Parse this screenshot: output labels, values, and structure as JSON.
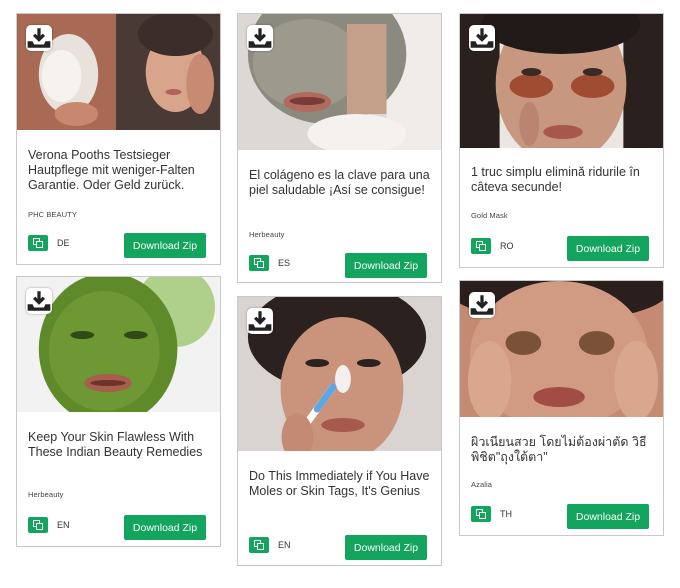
{
  "cards": [
    {
      "title": "Verona Pooths Testsieger Hautpflege mit weniger-Falten Garantie. Oder Geld zurück.",
      "brand": "PHC BEAUTY",
      "country": "DE",
      "button_label": "Download Zip",
      "image_desc": "two-faces-skincare-photo"
    },
    {
      "title": "El colágeno es la clave para una piel saludable ¡Así se consigue!",
      "brand": "Herbeauty",
      "country": "ES",
      "button_label": "Download Zip",
      "image_desc": "clay-mask-photo"
    },
    {
      "title": "1 truc simplu elimină ridurile în câteva secunde!",
      "brand": "Gold Mask",
      "country": "RO",
      "button_label": "Download Zip",
      "image_desc": "under-eye-patches-photo"
    },
    {
      "title": "Keep Your Skin Flawless With These Indian Beauty Remedies",
      "brand": "Herbeauty",
      "country": "EN",
      "button_label": "Download Zip",
      "image_desc": "green-face-mask-photo"
    },
    {
      "title": "Do This Immediately if You Have Moles or Skin Tags, It's Genius",
      "brand": "",
      "country": "EN",
      "button_label": "Download Zip",
      "image_desc": "nose-toothbrush-photo"
    },
    {
      "title": "ผิวเนียนสวย โดยไม่ต้องผ่าตัด วิธีพิชิต\"ถุงใต้ตา\"",
      "brand": "Azalia",
      "country": "TH",
      "button_label": "Download Zip",
      "image_desc": "eye-bags-photo"
    }
  ],
  "colors": {
    "accent_green": "#13a55d",
    "border": "#c9c9c9",
    "text": "#333333"
  },
  "icons": {
    "download": "download-icon",
    "copy": "copy-icon"
  }
}
